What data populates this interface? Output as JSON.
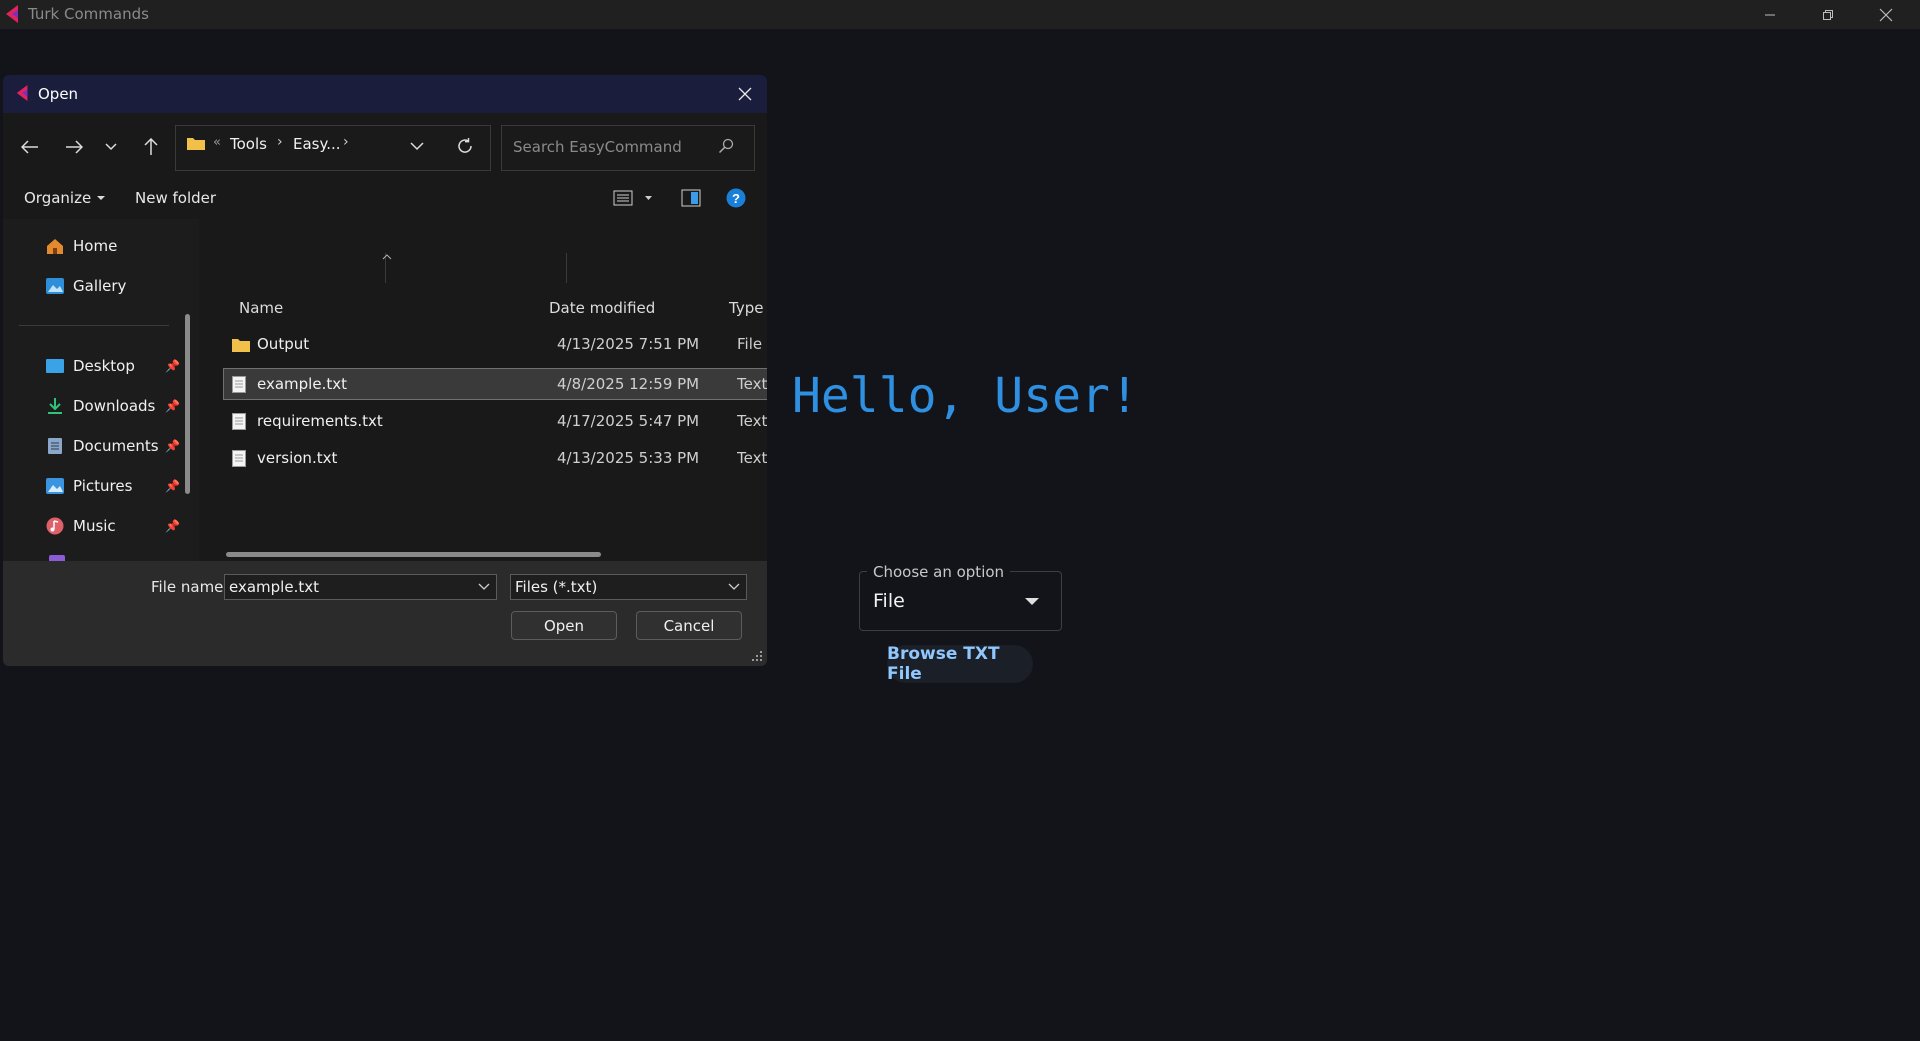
{
  "app": {
    "title": "Turk Commands",
    "greeting": "Hello, User!",
    "select": {
      "legend": "Choose an option",
      "value": "File"
    },
    "browse_label": "Browse TXT File",
    "accent": "#2f8fe0"
  },
  "dialog": {
    "title": "Open",
    "breadcrumb": {
      "overflow": "«",
      "items": [
        "Tools",
        "Easy..."
      ]
    },
    "search_placeholder": "Search EasyCommand",
    "toolbar": {
      "organize": "Organize",
      "new_folder": "New folder"
    },
    "nav": [
      {
        "label": "Home",
        "icon": "home-icon",
        "pinned": false
      },
      {
        "label": "Gallery",
        "icon": "gallery-icon",
        "pinned": false
      },
      {
        "label": "Desktop",
        "icon": "desktop-icon",
        "pinned": true
      },
      {
        "label": "Downloads",
        "icon": "downloads-icon",
        "pinned": true
      },
      {
        "label": "Documents",
        "icon": "documents-icon",
        "pinned": true
      },
      {
        "label": "Pictures",
        "icon": "pictures-icon",
        "pinned": true
      },
      {
        "label": "Music",
        "icon": "music-icon",
        "pinned": true
      }
    ],
    "columns": [
      "Name",
      "Date modified",
      "Type"
    ],
    "files": [
      {
        "name": "Output",
        "date": "4/13/2025 7:51 PM",
        "type": "File fo",
        "kind": "folder",
        "selected": false
      },
      {
        "name": "example.txt",
        "date": "4/8/2025 12:59 PM",
        "type": "Text D",
        "kind": "text",
        "selected": true
      },
      {
        "name": "requirements.txt",
        "date": "4/17/2025 5:47 PM",
        "type": "Text D",
        "kind": "text",
        "selected": false
      },
      {
        "name": "version.txt",
        "date": "4/13/2025 5:33 PM",
        "type": "Text D",
        "kind": "text",
        "selected": false
      }
    ],
    "footer": {
      "file_name_label": "File name:",
      "file_name_value": "example.txt",
      "filter": "Files (*.txt)",
      "open_label": "Open",
      "cancel_label": "Cancel"
    }
  }
}
